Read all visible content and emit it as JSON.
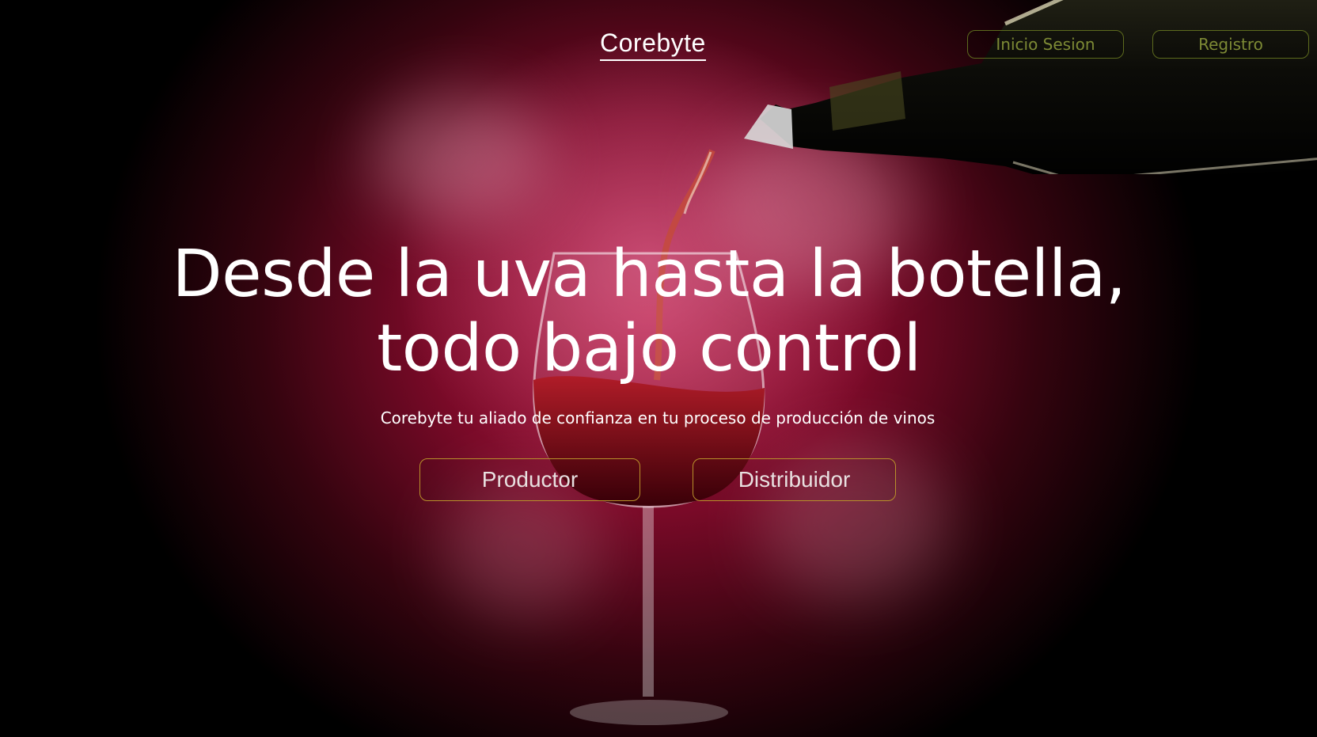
{
  "header": {
    "brand": "Corebyte",
    "login_label": "Inicio Sesion",
    "register_label": "Registro"
  },
  "hero": {
    "title_line1": "Desde la uva hasta la botella,",
    "title_line2": "todo bajo control",
    "subtitle": "Corebyte tu aliado de confianza en tu proceso de producción de vinos",
    "producer_label": "Productor",
    "distributor_label": "Distribuidor"
  },
  "colors": {
    "background_accent": "#b0143e",
    "nav_button_border": "#5d6b1e",
    "nav_button_text": "#7d8a35",
    "cta_border": "#b8902b"
  },
  "icons": {
    "background_image": "wine-pouring-illustration"
  }
}
